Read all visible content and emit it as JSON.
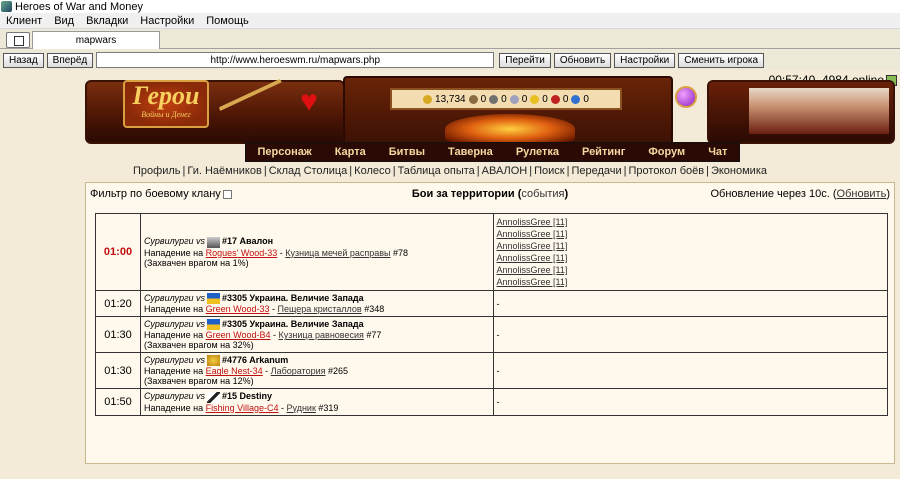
{
  "window": {
    "title": "Heroes of War and Money"
  },
  "menu": [
    "Клиент",
    "Вид",
    "Вкладки",
    "Настройки",
    "Помощь"
  ],
  "tab": {
    "label": "mapwars"
  },
  "nav": {
    "back": "Назад",
    "forward": "Вперёд",
    "url": "http://www.heroeswm.ru/mapwars.php",
    "go": "Перейти",
    "refresh": "Обновить",
    "settings": "Настройки",
    "switch_player": "Сменить игрока"
  },
  "status": {
    "time": "00:57:40, 4984 online"
  },
  "logo": {
    "line1": "Герои",
    "line2": "Войны и Денег"
  },
  "resources": [
    {
      "icon": "gold-icon",
      "value": "13,734",
      "color": "#d8a820"
    },
    {
      "icon": "wood-icon",
      "value": "0",
      "color": "#8a6a40"
    },
    {
      "icon": "ore-icon",
      "value": "0",
      "color": "#707070"
    },
    {
      "icon": "mercury-icon",
      "value": "0",
      "color": "#a0a0c0"
    },
    {
      "icon": "sulfur-icon",
      "value": "0",
      "color": "#e8c020"
    },
    {
      "icon": "crystal-icon",
      "value": "0",
      "color": "#c02020"
    },
    {
      "icon": "gems-icon",
      "value": "0",
      "color": "#3070d0"
    }
  ],
  "main_nav": [
    "Персонаж",
    "Карта",
    "Битвы",
    "Таверна",
    "Рулетка",
    "Рейтинг",
    "Форум",
    "Чат"
  ],
  "sub_nav": [
    "Профиль",
    "Ги. Наёмников",
    "Склад Столица",
    "Колесо",
    "Таблица опыта",
    "АВАЛОН",
    "Поиск",
    "Передачи",
    "Протокол боёв",
    "Экономика"
  ],
  "filter": {
    "label": "Фильтр по боевому клану"
  },
  "heading": {
    "title": "Бои за территории",
    "events_link": "события"
  },
  "refresh": {
    "prefix": "Обновление через 10с. (",
    "link": "Обновить",
    "suffix": ")"
  },
  "battles": [
    {
      "time": "01:00",
      "attacker": "Сурвилурги",
      "vs": "vs",
      "clan": "#17 Авалон",
      "clan_icon": "avalon-clan-icon",
      "attack_prefix": "Нападение на",
      "location": "Rogues' Wood-33",
      "building": "Кузница мечей расправы",
      "building_num": "#78",
      "captured": "(Захвачен врагом на 1%)",
      "defenders": [
        "AnnolissGree [11]",
        "AnnolissGree [11]",
        "AnnolissGree [11]",
        "AnnolissGree [11]",
        "AnnolissGree [11]",
        "AnnolissGree [11]"
      ]
    },
    {
      "time": "01:20",
      "attacker": "Сурвилурги",
      "vs": "vs",
      "clan": "#3305 Украина. Величие Запада",
      "clan_icon": "ukraine-clan-icon",
      "attack_prefix": "Нападение на",
      "location": "Green Wood-33",
      "building": "Пещера кристаллов",
      "building_num": "#348",
      "captured": "",
      "defenders_text": "-"
    },
    {
      "time": "01:30",
      "attacker": "Сурвилурги",
      "vs": "vs",
      "clan": "#3305 Украина. Величие Запада",
      "clan_icon": "ukraine-clan-icon",
      "attack_prefix": "Нападение на",
      "location": "Green Wood-B4",
      "building": "Кузница равновесия",
      "building_num": "#77",
      "captured": "(Захвачен врагом на 32%)",
      "defenders_text": "-"
    },
    {
      "time": "01:30",
      "attacker": "Сурвилурги",
      "vs": "vs",
      "clan": "#4776 Arkanum",
      "clan_icon": "arkanum-clan-icon",
      "attack_prefix": "Нападение на",
      "location": "Eagle Nest-34",
      "building": "Лаборатория",
      "building_num": "#265",
      "captured": "(Захвачен врагом на 12%)",
      "defenders_text": "-"
    },
    {
      "time": "01:50",
      "attacker": "Сурвилурги",
      "vs": "vs",
      "clan": "#15 Destiny",
      "clan_icon": "destiny-clan-icon",
      "attack_prefix": "Нападение на",
      "location": "Fishing Village-C4",
      "building": "Рудник",
      "building_num": "#319",
      "captured": "",
      "defenders_text": "-"
    }
  ]
}
